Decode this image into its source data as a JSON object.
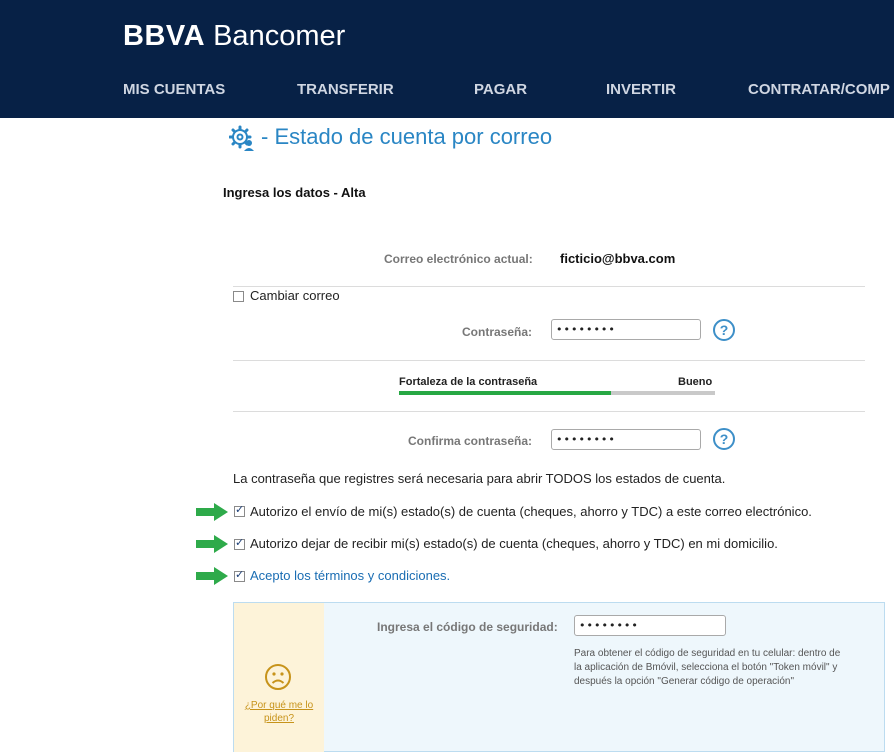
{
  "header": {
    "logo_bold": "BBVA",
    "logo_light": "Bancomer",
    "nav": [
      "MIS CUENTAS",
      "TRANSFERIR",
      "PAGAR",
      "INVERTIR",
      "CONTRATAR/COMP"
    ]
  },
  "page": {
    "title": "- Estado de cuenta por correo",
    "subtitle": "Ingresa los datos - Alta"
  },
  "form": {
    "current_email_label": "Correo electrónico actual:",
    "current_email_value": "ficticio@bbva.com",
    "change_email_label": "Cambiar correo",
    "change_email_checked": false,
    "password_label": "Contraseña:",
    "password_value": "••••••••",
    "strength_label": "Fortaleza de la contraseña",
    "strength_value": "Bueno",
    "strength_fraction": 0.67,
    "confirm_label": "Confirma contraseña:",
    "confirm_value": "••••••••",
    "help_glyph": "?",
    "info_text": "La contraseña que registres será necesaria para abrir TODOS los estados de cuenta.",
    "checks": [
      {
        "label": "Autorizo el envío de mi(s) estado(s) de cuenta (cheques, ahorro y TDC) a este correo electrónico.",
        "checked": true
      },
      {
        "label": "Autorizo dejar de recibir mi(s) estado(s) de cuenta (cheques, ahorro y TDC) en mi domicilio.",
        "checked": true
      },
      {
        "label": "Acepto los términos y condiciones.",
        "checked": true
      }
    ]
  },
  "security": {
    "why_link": "¿Por qué me lo piden?",
    "code_label": "Ingresa el código de seguridad:",
    "code_value": "••••••••",
    "note": "Para obtener el código de seguridad en tu celular: dentro de la aplicación de Bmóvil, selecciona el botón \"Token móvil\" y después la opción \"Generar código de operación\""
  },
  "colors": {
    "header_bg": "#072146",
    "accent_blue": "#2a86c4",
    "arrow_green": "#2eaa4a",
    "strength_green": "#27a844"
  },
  "icons": {
    "title": "gear-user-icon",
    "help": "help-circle-icon",
    "arrow": "right-arrow-icon",
    "face": "sad-face-icon"
  }
}
